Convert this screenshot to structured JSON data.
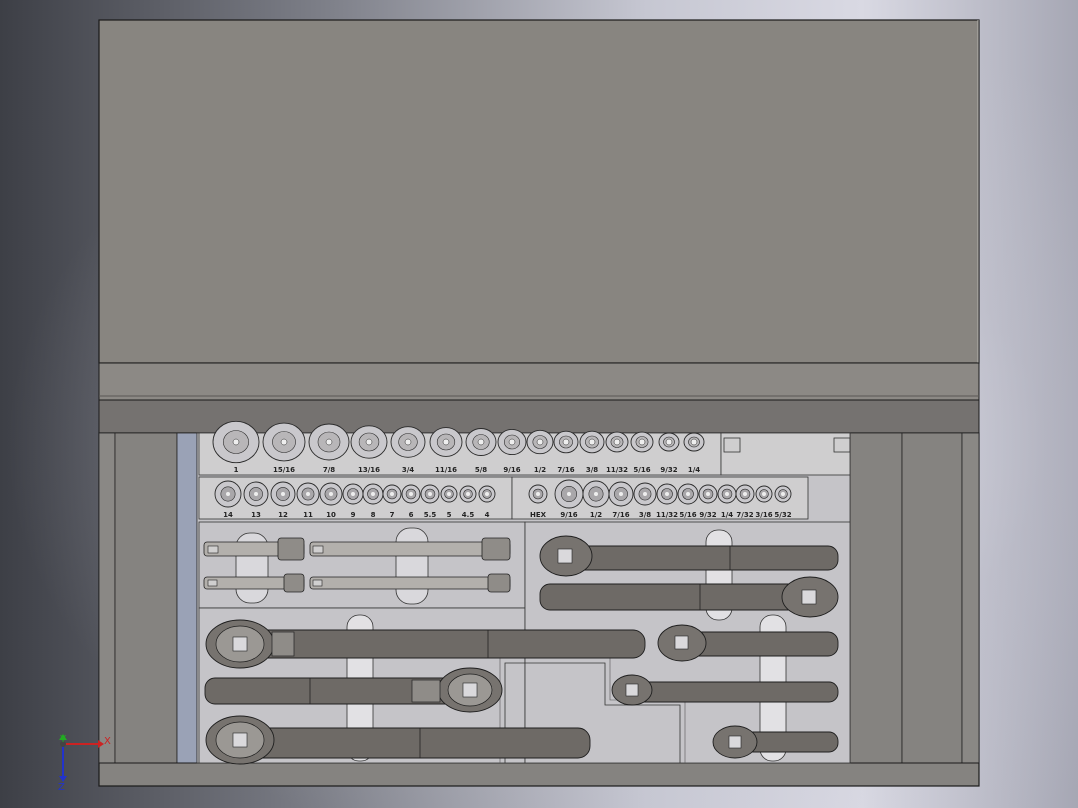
{
  "viewport": {
    "type": "cad-3d-viewport"
  },
  "top_row_labels": [
    "1",
    "15/16",
    "7/8",
    "13/16",
    "3/4",
    "11/16",
    "5/8",
    "9/16",
    "1/2",
    "7/16",
    "3/8",
    "11/32",
    "5/16",
    "9/32",
    "1/4"
  ],
  "mid_left_labels": [
    "14",
    "13",
    "12",
    "11",
    "10",
    "9",
    "8",
    "7",
    "6",
    "5.5",
    "5",
    "4.5",
    "4"
  ],
  "mid_right_labels": [
    "HEX",
    "9/16",
    "1/2",
    "7/16",
    "3/8",
    "11/32",
    "5/16",
    "9/32",
    "1/4",
    "7/32",
    "3/16",
    "5/32"
  ],
  "triad": {
    "x_label": "X",
    "y_label": "Y",
    "z_label": "Z"
  },
  "colors": {
    "panel": "#888580",
    "tray": "#c5c4c8",
    "tool": "#6e6a66",
    "axis_x": "#cc2222",
    "axis_y": "#22aa22",
    "axis_z": "#2233cc"
  }
}
